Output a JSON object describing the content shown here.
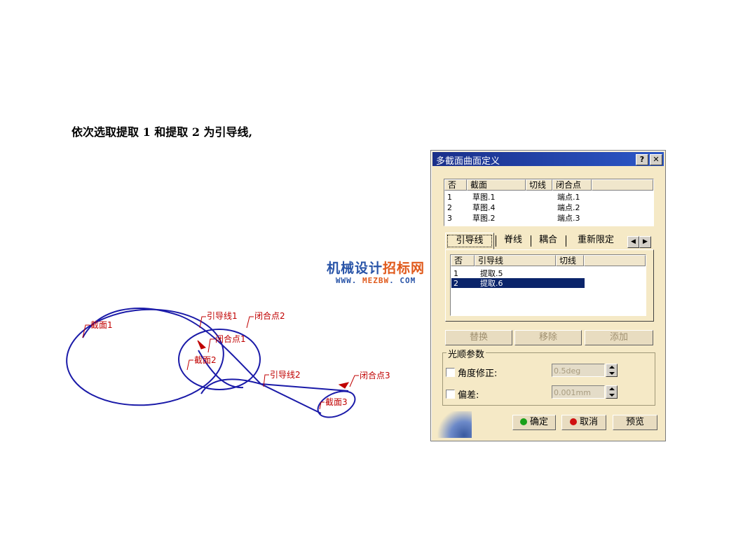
{
  "instruction": "依次选取提取 1 和提取 2 为引导线,",
  "watermark": {
    "title_a": "机械设计",
    "title_b": "招标网",
    "url_a": "WWW. ",
    "url_b": "MEZBW",
    "url_c": ". COM"
  },
  "sketch": {
    "curve_color": "#1a1aa8",
    "label_color": "#c00000",
    "labels": {
      "section1": "截面1",
      "section2": "截面2",
      "section3": "截面3",
      "guide1": "引导线1",
      "guide2": "引导线2",
      "closing1": "闭合点1",
      "closing2": "闭合点2",
      "closing3": "闭合点3"
    }
  },
  "dialog": {
    "title": "多截面曲面定义",
    "help_button": "?",
    "close_button": "✕",
    "sections_list": {
      "headers": [
        "否",
        "截面",
        "切线",
        "闭合点"
      ],
      "rows": [
        {
          "no": "1",
          "section": "草图.1",
          "tangent": "",
          "closing": "端点.1"
        },
        {
          "no": "2",
          "section": "草图.4",
          "tangent": "",
          "closing": "端点.2"
        },
        {
          "no": "3",
          "section": "草图.2",
          "tangent": "",
          "closing": "端点.3"
        }
      ]
    },
    "tabs": [
      "引导线",
      "脊线",
      "耦合",
      "重新限定"
    ],
    "guides_list": {
      "headers": [
        "否",
        "引导线",
        "切线"
      ],
      "rows": [
        {
          "no": "1",
          "guide": "提取.5",
          "tangent": ""
        },
        {
          "no": "2",
          "guide": "提取.6",
          "tangent": ""
        }
      ],
      "selected_row": 2
    },
    "buttons": {
      "replace": "替换",
      "remove": "移除",
      "add": "添加"
    },
    "smoothing": {
      "group_title": "光顺参数",
      "angle_label": "角度修正:",
      "angle_value": "0.5deg",
      "deviation_label": "偏差:",
      "deviation_value": "0.001mm"
    },
    "footer": {
      "ok": "确定",
      "cancel": "取消",
      "preview": "预览"
    },
    "colors": {
      "title_bar": "#1a2f8a",
      "panel": "#f5e9c6",
      "ok_dot": "#1aa01a",
      "cancel_dot": "#d01010"
    }
  }
}
